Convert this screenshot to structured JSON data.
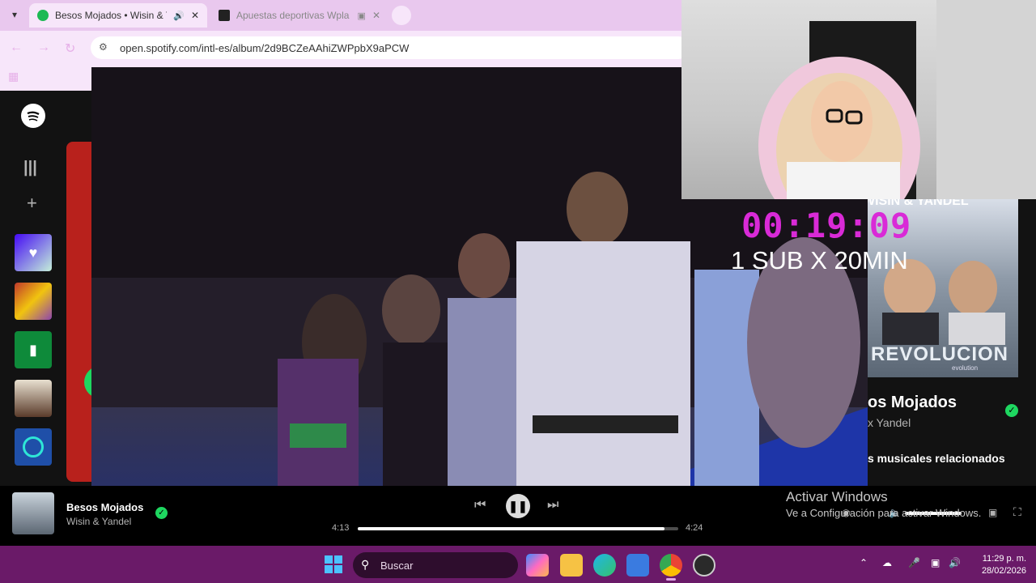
{
  "browser": {
    "tabs": [
      {
        "title": "Besos Mojados • Wisin & Y",
        "active": true
      },
      {
        "title": "Apuestas deportivas Wpla",
        "active": false
      }
    ],
    "url": "open.spotify.com/intl-es/album/2d9BCZeAAhiZWPpbX9aPCW"
  },
  "overlay": {
    "timer": "00:19:09",
    "subtext": "1 SUB X 20MIN"
  },
  "album": {
    "art_artist": "WISIN & YANDEL",
    "art_title": "REVOLUCION",
    "art_subtitle": "evolution",
    "title_partial": "os Mojados",
    "artist_partial": "x Yandel",
    "related_partial": "s musicales relacionados"
  },
  "player": {
    "track": "Besos Mojados",
    "artist": "Wisin & Yandel",
    "elapsed": "4:13",
    "total": "4:24",
    "progress": 0.956
  },
  "windows_watermark": {
    "line1": "Activar Windows",
    "line2": "Ve a Configuración para activar Windows."
  },
  "taskbar": {
    "search_label": "Buscar",
    "time": "11:29 p. m.",
    "date": "28/02/2026"
  },
  "colors": {
    "spotify_green": "#1db954",
    "timer_magenta": "#d92ad7",
    "taskbar": "#6a1a68",
    "chrome_tab": "#e9c8ee"
  }
}
